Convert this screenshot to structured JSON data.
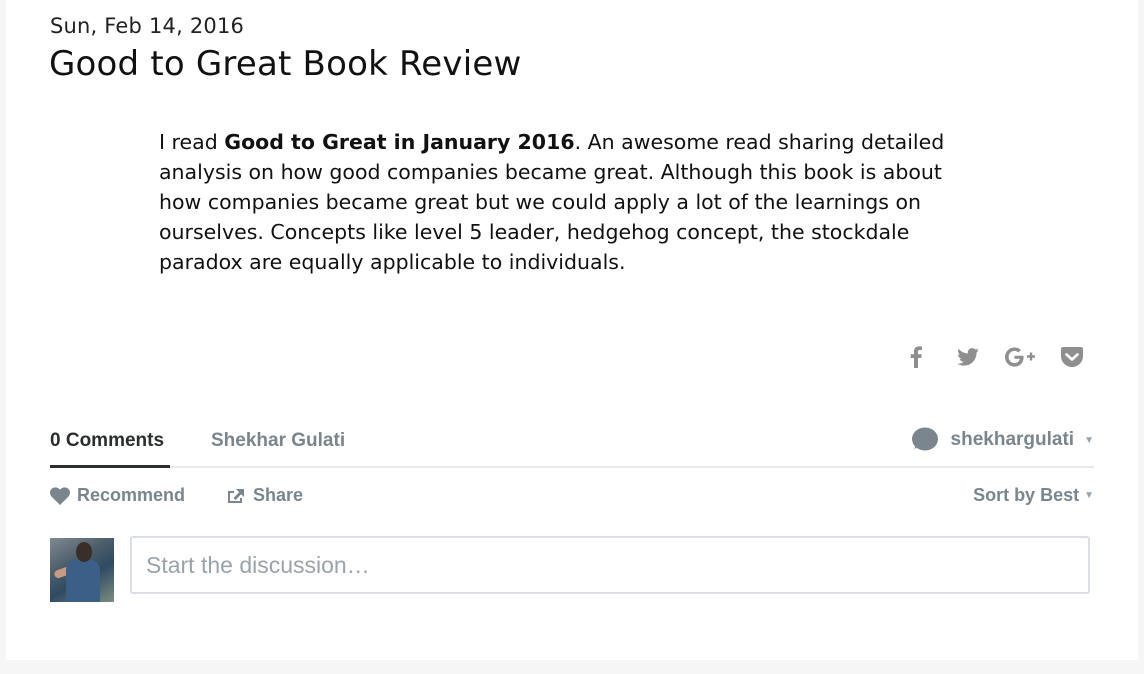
{
  "post": {
    "date": "Sun, Feb 14, 2016",
    "title": "Good to Great Book Review",
    "body_prefix": "I read ",
    "body_bold": "Good to Great in January 2016",
    "body_rest": ". An awesome read sharing detailed analysis on how good companies became great. Although this book is about how companies became great but we could apply a lot of the learnings on ourselves. Concepts like level 5 leader, hedgehog concept, the stockdale paradox are equally applicable to individuals."
  },
  "share": {
    "icons": [
      "facebook-icon",
      "twitter-icon",
      "google-plus-icon",
      "pocket-icon"
    ]
  },
  "comments": {
    "count_tab": "0 Comments",
    "site_tab": "Shekhar Gulati",
    "username": "shekhargulati",
    "recommend_label": "Recommend",
    "share_label": "Share",
    "sort_label": "Sort by Best",
    "input_placeholder": "Start the discussion…"
  },
  "colors": {
    "muted_text": "#7a858d",
    "icon_gray": "#8f8f8f",
    "border": "#dbdfe4"
  }
}
